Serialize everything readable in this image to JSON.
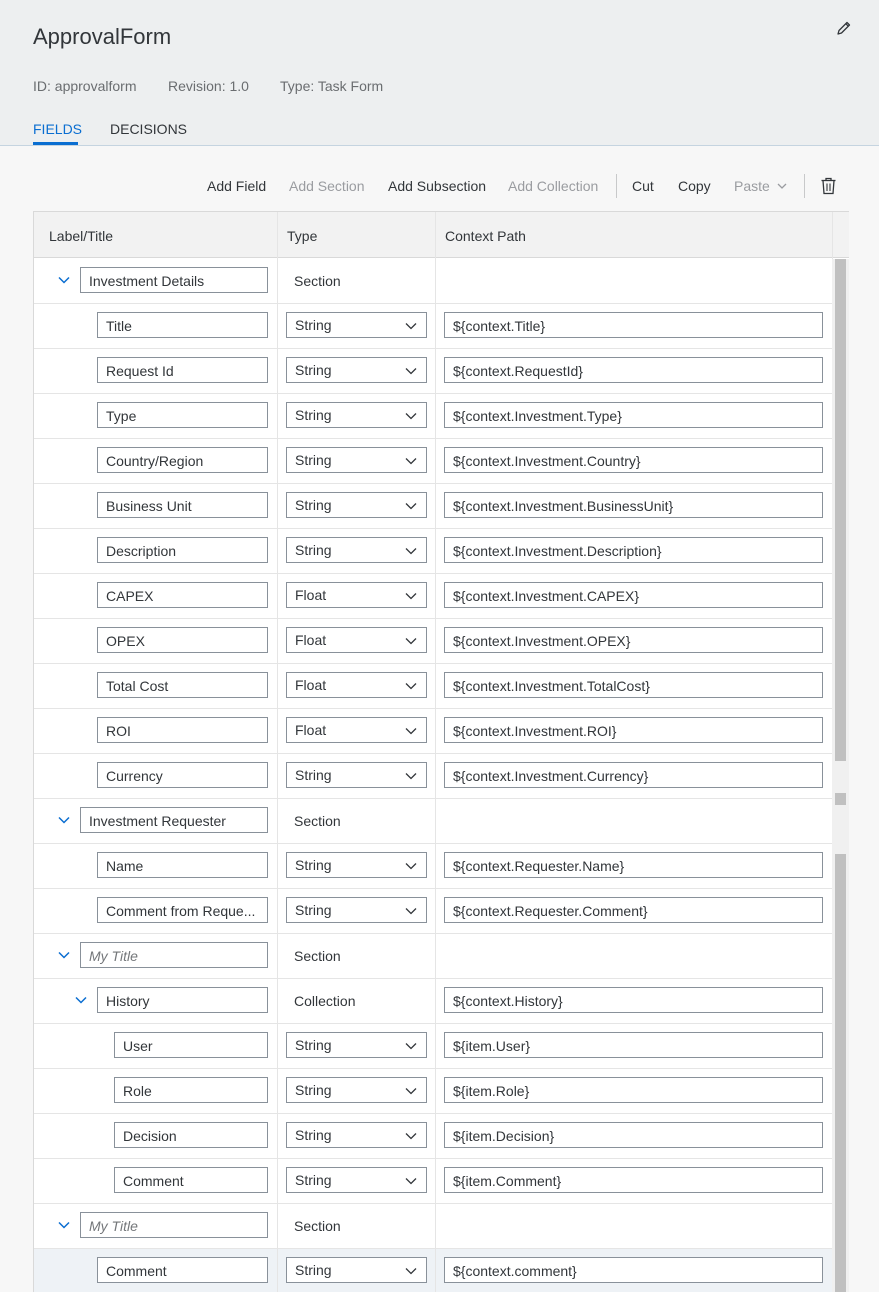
{
  "header": {
    "title": "ApprovalForm",
    "meta": {
      "id": "ID: approvalform",
      "revision": "Revision: 1.0",
      "type": "Type: Task Form"
    },
    "tabs": [
      {
        "label": "FIELDS",
        "active": true
      },
      {
        "label": "DECISIONS",
        "active": false
      }
    ]
  },
  "toolbar": {
    "add_field": "Add Field",
    "add_section": "Add Section",
    "add_subsection": "Add Subsection",
    "add_collection": "Add Collection",
    "cut": "Cut",
    "copy": "Copy",
    "paste": "Paste"
  },
  "table": {
    "columns": {
      "label": "Label/Title",
      "type": "Type",
      "path": "Context Path"
    },
    "rows": [
      {
        "kind": "section",
        "label": "Investment Details",
        "type": "Section",
        "path": ""
      },
      {
        "kind": "field",
        "label": "Title",
        "type": "String",
        "path": "${context.Title}"
      },
      {
        "kind": "field",
        "label": "Request Id",
        "type": "String",
        "path": "${context.RequestId}"
      },
      {
        "kind": "field",
        "label": "Type",
        "type": "String",
        "path": "${context.Investment.Type}"
      },
      {
        "kind": "field",
        "label": "Country/Region",
        "type": "String",
        "path": "${context.Investment.Country}"
      },
      {
        "kind": "field",
        "label": "Business Unit",
        "type": "String",
        "path": "${context.Investment.BusinessUnit}"
      },
      {
        "kind": "field",
        "label": "Description",
        "type": "String",
        "path": "${context.Investment.Description}"
      },
      {
        "kind": "field",
        "label": "CAPEX",
        "type": "Float",
        "path": "${context.Investment.CAPEX}"
      },
      {
        "kind": "field",
        "label": "OPEX",
        "type": "Float",
        "path": "${context.Investment.OPEX}"
      },
      {
        "kind": "field",
        "label": "Total Cost",
        "type": "Float",
        "path": "${context.Investment.TotalCost}"
      },
      {
        "kind": "field",
        "label": "ROI",
        "type": "Float",
        "path": "${context.Investment.ROI}"
      },
      {
        "kind": "field",
        "label": "Currency",
        "type": "String",
        "path": "${context.Investment.Currency}"
      },
      {
        "kind": "section",
        "label": "Investment Requester",
        "type": "Section",
        "path": ""
      },
      {
        "kind": "field",
        "label": "Name",
        "type": "String",
        "path": "${context.Requester.Name}"
      },
      {
        "kind": "field",
        "label": "Comment from Reque...",
        "type": "String",
        "path": "${context.Requester.Comment}"
      },
      {
        "kind": "section",
        "label": "",
        "placeholder": "My Title",
        "type": "Section",
        "path": ""
      },
      {
        "kind": "collection",
        "label": "History",
        "type": "Collection",
        "path": "${context.History}"
      },
      {
        "kind": "item",
        "label": "User",
        "type": "String",
        "path": "${item.User}"
      },
      {
        "kind": "item",
        "label": "Role",
        "type": "String",
        "path": "${item.Role}"
      },
      {
        "kind": "item",
        "label": "Decision",
        "type": "String",
        "path": "${item.Decision}"
      },
      {
        "kind": "item",
        "label": "Comment",
        "type": "String",
        "path": "${item.Comment}"
      },
      {
        "kind": "section",
        "label": "",
        "placeholder": "My Title",
        "type": "Section",
        "path": ""
      },
      {
        "kind": "field",
        "label": "Comment",
        "type": "String",
        "path": "${context.comment}",
        "selected": true
      }
    ]
  },
  "colors": {
    "accent": "#0a6ed1",
    "header_bg": "#edeff0",
    "border": "#89919a"
  },
  "icons": {
    "edit": "pencil-icon",
    "delete": "trash-icon",
    "expand": "chevron-down-icon",
    "dropdown": "chevron-down-icon"
  }
}
